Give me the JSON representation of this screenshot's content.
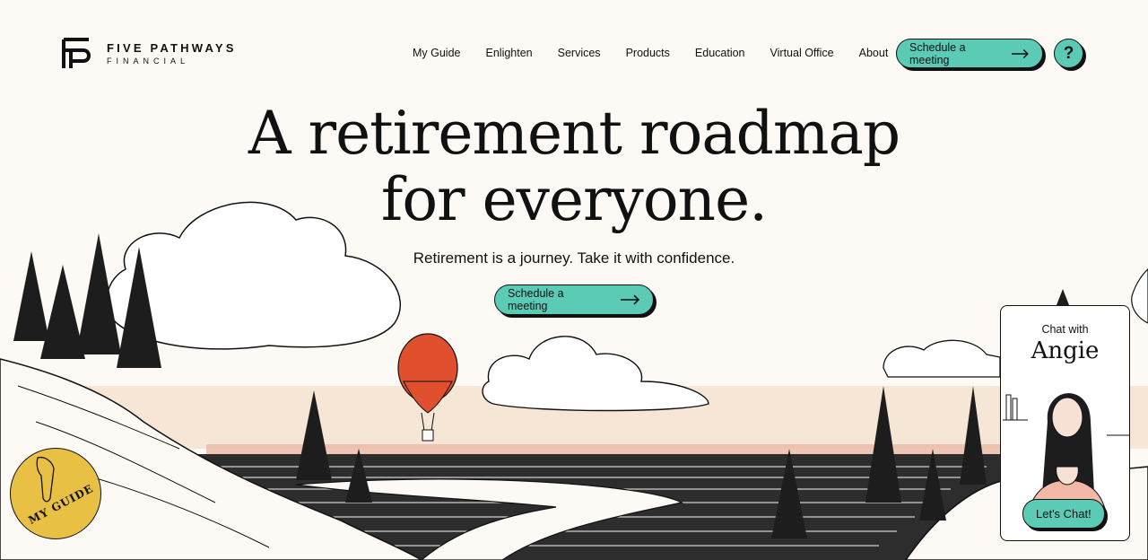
{
  "brand": {
    "line1": "FIVE PATHWAYS",
    "line2": "FINANCIAL"
  },
  "nav": [
    "My Guide",
    "Enlighten",
    "Services",
    "Products",
    "Education",
    "Virtual Office",
    "About"
  ],
  "header_cta": "Schedule a meeting",
  "help_label": "?",
  "hero": {
    "title_line1": "A retirement roadmap",
    "title_line2": "for everyone.",
    "subtitle": "Retirement is a journey. Take it with confidence.",
    "cta": "Schedule a meeting"
  },
  "chat": {
    "prefix": "Chat with",
    "name": "Angie",
    "button": "Let's Chat!"
  },
  "badge": {
    "label": "MY GUIDE"
  },
  "colors": {
    "accent": "#5ccbb6",
    "background": "#fdf9f5",
    "balloon": "#e0502f",
    "badge": "#e8c044",
    "horizon": "#f3d8c4"
  }
}
